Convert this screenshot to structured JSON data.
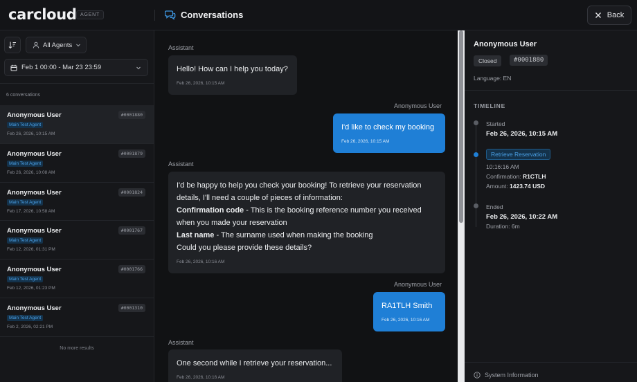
{
  "app": {
    "logo": "carcloud",
    "badge": "AGENT",
    "title": "Conversations",
    "back_label": "Back"
  },
  "filters": {
    "agents_label": "All Agents",
    "date_range": "Feb 1 00:00 - Mar 23 23:59",
    "count_label": "6 conversations",
    "no_more": "No more results"
  },
  "conversations": [
    {
      "name": "Anonymous User",
      "id": "#0001880",
      "agent": "Main Test Agent",
      "date": "Feb 26, 2026, 10:15 AM"
    },
    {
      "name": "Anonymous User",
      "id": "#0001879",
      "agent": "Main Test Agent",
      "date": "Feb 26, 2026, 10:08 AM"
    },
    {
      "name": "Anonymous User",
      "id": "#0001824",
      "agent": "Main Test Agent",
      "date": "Feb 17, 2026, 10:58 AM"
    },
    {
      "name": "Anonymous User",
      "id": "#0001767",
      "agent": "Main Test Agent",
      "date": "Feb 12, 2026, 01:31 PM"
    },
    {
      "name": "Anonymous User",
      "id": "#0001766",
      "agent": "Main Test Agent",
      "date": "Feb 12, 2026, 01:23 PM"
    },
    {
      "name": "Anonymous User",
      "id": "#0001310",
      "agent": "Main Test Agent",
      "date": "Feb 2, 2026, 02:21 PM"
    }
  ],
  "messages": [
    {
      "role": "Assistant",
      "text": "Hello! How can I help you today?",
      "time": "Feb 26, 2026, 10:15 AM"
    },
    {
      "role": "Anonymous User",
      "text": "I'd like to check my booking",
      "time": "Feb 26, 2026, 10:15 AM"
    },
    {
      "role": "Assistant",
      "line1": "I'd be happy to help you check your booking! To retrieve your reservation",
      "line2": "details, I'll need a couple of pieces of information:",
      "b1_bold": "Confirmation code",
      "b1_rest": " - This is the booking reference number you received",
      "b1_line2": "when you made your reservation",
      "b2_bold": "Last name",
      "b2_rest": " - The surname used when making the booking",
      "line_last": "Could you please provide these details?",
      "time": "Feb 26, 2026, 10:16 AM"
    },
    {
      "role": "Anonymous User",
      "text": "RA1TLH Smith",
      "time": "Feb 26, 2026, 10:16 AM"
    },
    {
      "role": "Assistant",
      "text": "One second while I retrieve your reservation...",
      "time": "Feb 26, 2026, 10:16 AM"
    }
  ],
  "details": {
    "name": "Anonymous User",
    "status": "Closed",
    "id": "#0001880",
    "language": "Language: EN",
    "timeline_heading": "TIMELINE",
    "started_label": "Started",
    "started_value": "Feb 26, 2026, 10:15 AM",
    "tool_tag": "Retrieve Reservation",
    "tool_time": "10:16:16 AM",
    "confirmation_label": "Confirmation:",
    "confirmation_value": "R1CTLH",
    "amount_label": "Amount:",
    "amount_value": "1423.74 USD",
    "ended_label": "Ended",
    "ended_value": "Feb 26, 2026, 10:22 AM",
    "duration": "Duration: 6m",
    "system_info": "System Information"
  },
  "colors": {
    "accent": "#1f7fd6",
    "background": "#111214",
    "panel": "#16171a"
  }
}
